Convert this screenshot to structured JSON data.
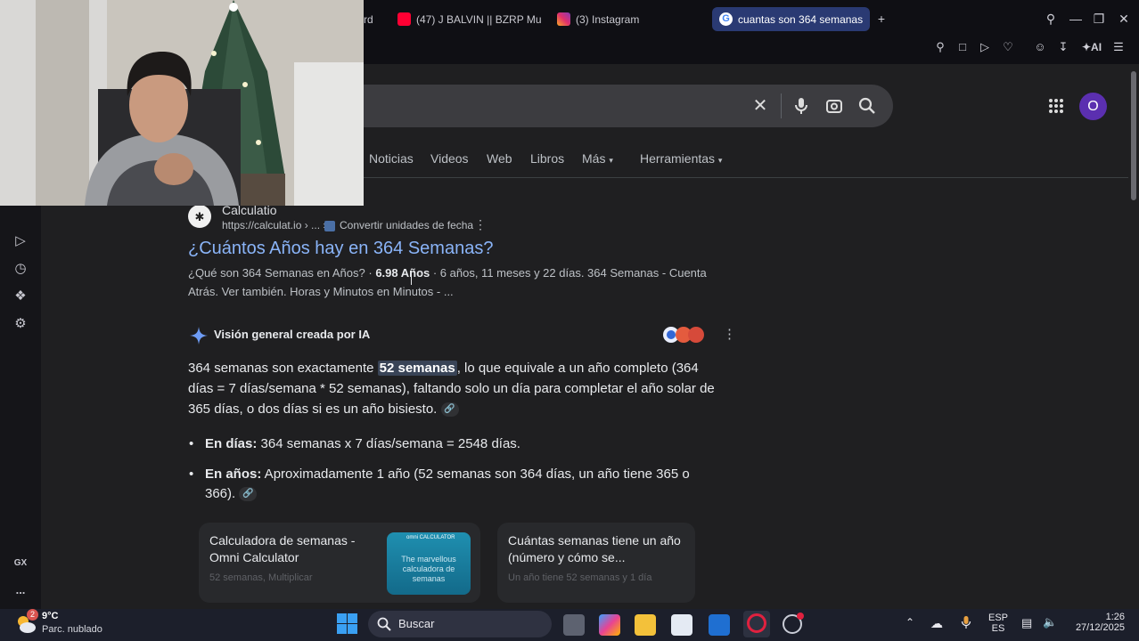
{
  "tabs": [
    {
      "label": "rd",
      "active": false
    },
    {
      "label": "(47) J BALVIN || BZRP Mu",
      "active": false
    },
    {
      "label": "(3) Instagram",
      "active": false
    },
    {
      "label": "cuantas son 364 semanas",
      "active": true
    }
  ],
  "new_tab": "+",
  "toolbar": {
    "ai_label": "AI"
  },
  "search": {
    "avatar_letter": "O"
  },
  "nav_tabs": [
    "Noticias",
    "Videos",
    "Web",
    "Libros",
    "Más",
    "Herramientas"
  ],
  "result": {
    "site_name": "Calculatio",
    "url": "https://calculat.io › ... ›",
    "breadcrumb": "Convertir unidades de fecha",
    "title": "¿Cuántos Años hay en 364 Semanas?",
    "snippet_pre": "¿Qué son 364 Semanas en Años? · ",
    "snippet_bold": "6.98 Años",
    "snippet_post": " · 6 años, 11 meses y 22 días. 364 Semanas - Cuenta Atrás. Ver también. Horas y Minutos en Minutos - ..."
  },
  "ai_overview": {
    "title": "Visión general creada por IA",
    "para_pre": "364 semanas son exactamente ",
    "para_highlight": "52 semanas",
    "para_post": ", lo que equivale a un año completo (364 días = 7 días/semana * 52 semanas), faltando solo un día para completar el año solar de 365 días, o dos días si es un año bisiesto.",
    "bullets": [
      {
        "bold": "En días:",
        "text": " 364 semanas x 7 días/semana = 2548 días."
      },
      {
        "bold": "En años:",
        "text": " Aproximadamente 1 año (52 semanas son 364 días, un año tiene 365 o 366)."
      }
    ],
    "cards": [
      {
        "title": "Calculadora de semanas - Omni Calculator",
        "fade": "52 semanas, Multiplicar"
      },
      {
        "title": "Cuántas semanas tiene un año (número y cómo se...",
        "fade": "Un año tiene 52 semanas y 1 día"
      }
    ],
    "thumb_text": "The marvellous calculadora de semanas",
    "thumb_brand": "omni CALCULATOR"
  },
  "sidebar": {
    "gx_label": "GX",
    "more": "..."
  },
  "taskbar": {
    "weather_temp": "9°C",
    "weather_desc": "Parc. nublado",
    "weather_badge": "2",
    "search_label": "Buscar",
    "lang_top": "ESP",
    "lang_bottom": "ES",
    "time": "1:26",
    "date": "27/12/2025"
  }
}
